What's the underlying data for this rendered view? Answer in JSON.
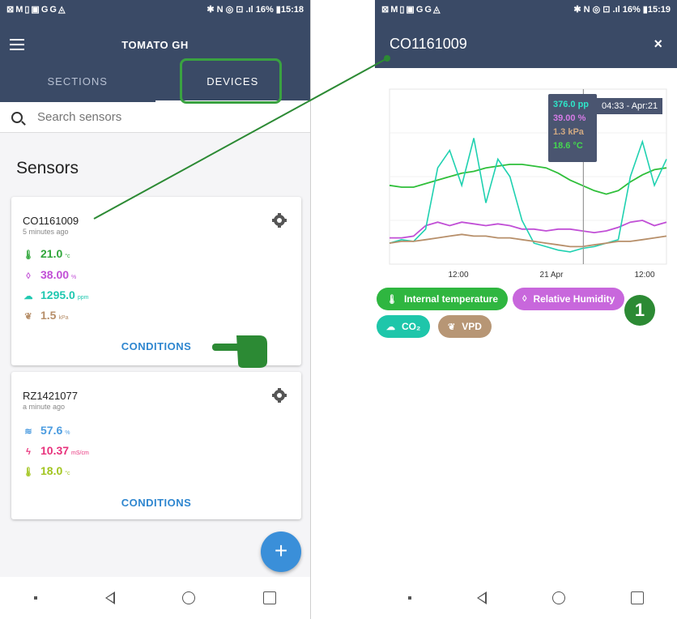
{
  "left": {
    "status_left": "⊠M▯▣GG◬",
    "status_right": "✱ N ◎ ⊡ .ıl 16% ▮15:18",
    "app_title": "TOMATO GH",
    "tabs": {
      "sections": "SECTIONS",
      "devices": "DEVICES"
    },
    "search_placeholder": "Search sensors",
    "heading": "Sensors",
    "cards": [
      {
        "name": "CO1161009",
        "time": "5 minutes ago",
        "readings": [
          {
            "icon": "thermometer-icon",
            "value": "21.0",
            "unit": "°c",
            "color": "#2fa63a"
          },
          {
            "icon": "droplet-icon",
            "value": "38.00",
            "unit": "%",
            "color": "#c14fd6"
          },
          {
            "icon": "cloud-icon",
            "value": "1295.0",
            "unit": "ppm",
            "color": "#1fc8b0"
          },
          {
            "icon": "leaf-icon",
            "value": "1.5",
            "unit": "kPa",
            "color": "#b78f6a"
          }
        ],
        "button": "CONDITIONS"
      },
      {
        "name": "RZ1421077",
        "time": "a minute ago",
        "readings": [
          {
            "icon": "waves-icon",
            "value": "57.6",
            "unit": "%",
            "color": "#4a9be0"
          },
          {
            "icon": "bolt-icon",
            "value": "10.37",
            "unit": "mS/cm",
            "color": "#e8327c"
          },
          {
            "icon": "thermometer-icon",
            "value": "18.0",
            "unit": "°c",
            "color": "#a2c51f"
          }
        ],
        "button": "CONDITIONS"
      }
    ],
    "fab": "+"
  },
  "right": {
    "status_left": "⊠M▯▣GG◬",
    "status_right": "✱ N ◎ ⊡ .ıl 16% ▮15:19",
    "device_title": "CO1161009",
    "close": "×",
    "chart_data": {
      "type": "line",
      "x_ticks": [
        "12:00",
        "21 Apr",
        "12:00"
      ],
      "series": [
        {
          "name": "Internal temperature",
          "color": "#2fbf3a",
          "values": [
            0.45,
            0.44,
            0.44,
            0.46,
            0.48,
            0.5,
            0.52,
            0.53,
            0.55,
            0.56,
            0.57,
            0.57,
            0.56,
            0.55,
            0.52,
            0.48,
            0.45,
            0.42,
            0.4,
            0.42,
            0.47,
            0.51,
            0.54,
            0.55
          ]
        },
        {
          "name": "Relative Humidity",
          "color": "#c14fd6",
          "values": [
            0.15,
            0.15,
            0.16,
            0.22,
            0.24,
            0.22,
            0.24,
            0.23,
            0.22,
            0.23,
            0.22,
            0.2,
            0.2,
            0.19,
            0.2,
            0.2,
            0.19,
            0.18,
            0.19,
            0.21,
            0.24,
            0.25,
            0.22,
            0.24
          ]
        },
        {
          "name": "CO2",
          "color": "#1fd1b0",
          "values": [
            0.12,
            0.14,
            0.13,
            0.2,
            0.55,
            0.65,
            0.45,
            0.72,
            0.35,
            0.6,
            0.5,
            0.25,
            0.12,
            0.1,
            0.08,
            0.07,
            0.09,
            0.1,
            0.12,
            0.14,
            0.5,
            0.7,
            0.45,
            0.6
          ]
        },
        {
          "name": "VPD",
          "color": "#b78f6a",
          "values": [
            0.12,
            0.13,
            0.13,
            0.14,
            0.15,
            0.16,
            0.17,
            0.16,
            0.16,
            0.15,
            0.15,
            0.14,
            0.13,
            0.12,
            0.11,
            0.1,
            0.1,
            0.11,
            0.12,
            0.13,
            0.13,
            0.14,
            0.15,
            0.16
          ]
        }
      ],
      "tooltip": {
        "time": "04:33 - Apr:21",
        "co2": "376.0 pp",
        "rh": "39.00 %",
        "vpd": "1.3 kPa",
        "temp": "18.6 °C",
        "cursor_at": 0.7
      }
    },
    "chips": [
      {
        "label": "Internal temperature",
        "color": "#2fb640"
      },
      {
        "label": "Relative Humidity",
        "color": "#c867dc"
      },
      {
        "label": "CO₂",
        "color": "#1ec6aa"
      },
      {
        "label": "VPD",
        "color": "#b79675"
      }
    ],
    "badge": "1"
  },
  "annotation_color": "#2c8a34"
}
